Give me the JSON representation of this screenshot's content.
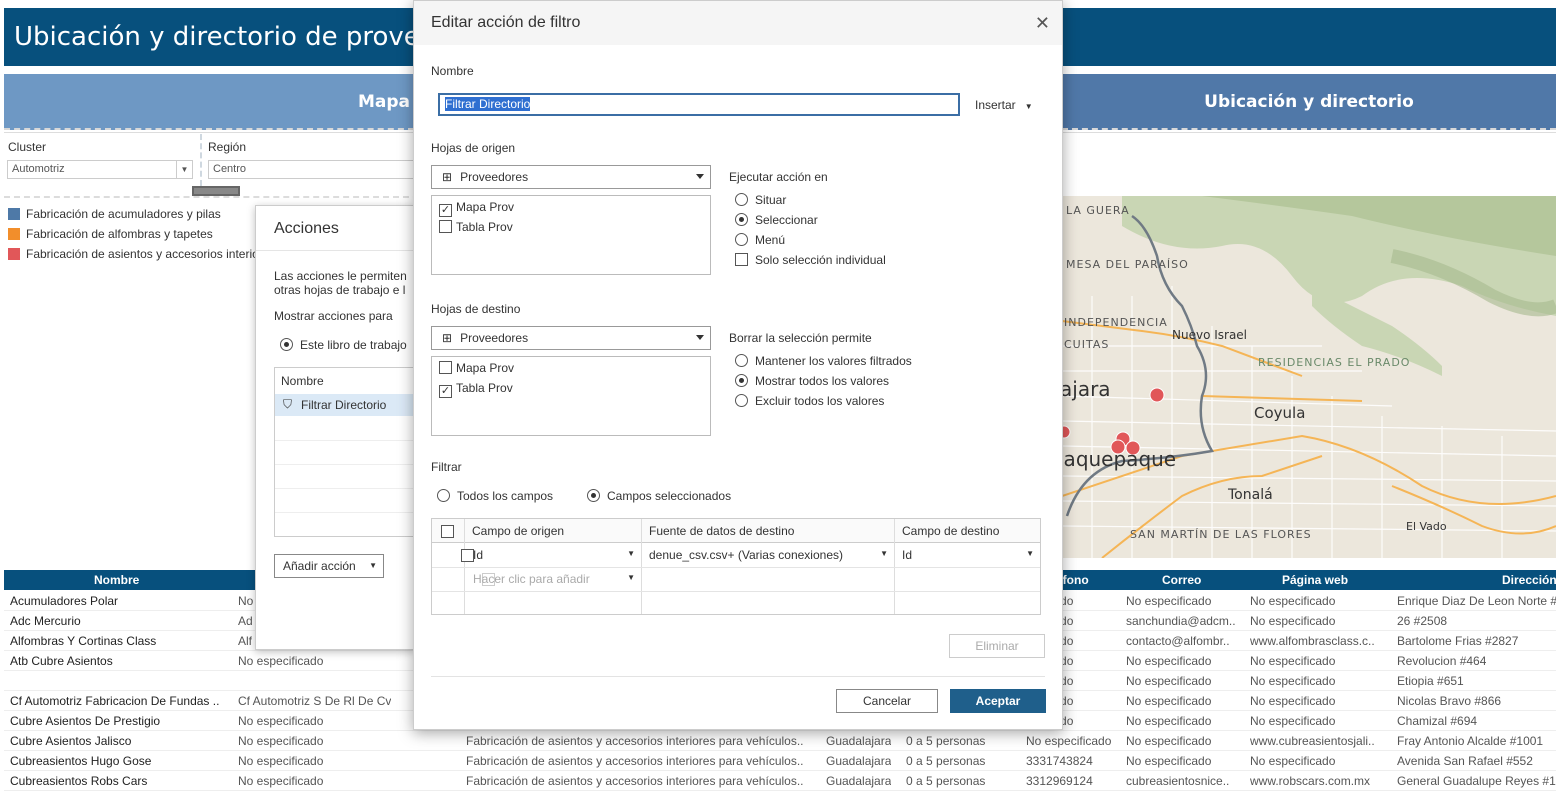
{
  "dashboard": {
    "title": "Ubicación y directorio de proveedores",
    "header_left": "Mapa",
    "header_right": "Ubicación y directorio",
    "filters": {
      "cluster_label": "Cluster",
      "cluster_value": "Automotriz",
      "region_label": "Región",
      "region_value": "Centro"
    },
    "legend": [
      {
        "label": "Fabricación de acumuladores y pilas",
        "color": "#4e79a7"
      },
      {
        "label": "Fabricación de alfombras y tapetes",
        "color": "#f28e2b"
      },
      {
        "label": "Fabricación de asientos y accesorios interiores para vehículos",
        "color": "#e15759"
      }
    ],
    "map_labels": [
      "LA GUERA",
      "MESA DEL PARAÍSO",
      "INDEPENDENCIA",
      "CUITAS",
      "Nuevo Israel",
      "RESIDENCIAS EL PRADO",
      "ajara",
      "Coyula",
      "laquepaque",
      "Tonalá",
      "SAN MARTÍN DE LAS FLORES",
      "El Vado"
    ],
    "table": {
      "headers": {
        "nombre": "Nombre",
        "telefono": "éfono",
        "correo": "Correo",
        "web": "Página web",
        "direccion": "Dirección"
      },
      "rows": [
        {
          "nombre": "Acumuladores Polar",
          "razon": "No",
          "actividad": "",
          "ciudad": "",
          "personal": "",
          "telefono": "ecificado",
          "correo": "No especificado",
          "web": "No especificado",
          "direccion": "Enrique Diaz De Leon Norte #"
        },
        {
          "nombre": "Adc Mercurio",
          "razon": "Ad",
          "actividad": "",
          "ciudad": "",
          "personal": "",
          "telefono": "ecificado",
          "correo": "sanchundia@adcm..",
          "web": "No especificado",
          "direccion": "26 #2508"
        },
        {
          "nombre": "Alfombras Y Cortinas Class",
          "razon": "Alf",
          "actividad": "",
          "ciudad": "",
          "personal": "",
          "telefono": "ecificado",
          "correo": "contacto@alfombr..",
          "web": "www.alfombrasclass.c..",
          "direccion": "Bartolome Frias #2827"
        },
        {
          "nombre": "Atb Cubre Asientos",
          "razon": "No especificado",
          "actividad": "",
          "ciudad": "",
          "personal": "",
          "telefono": "ecificado",
          "correo": "No especificado",
          "web": "No especificado",
          "direccion": "Revolucion #464"
        },
        {
          "nombre": "",
          "razon": "",
          "actividad": "",
          "ciudad": "",
          "personal": "",
          "telefono": "ecificado",
          "correo": "No especificado",
          "web": "No especificado",
          "direccion": "Etiopia #651"
        },
        {
          "nombre": "Cf Automotriz Fabricacion De Fundas ..",
          "razon": "Cf Automotriz S De Rl De Cv",
          "actividad": "",
          "ciudad": "",
          "personal": "",
          "telefono": "ecificado",
          "correo": "No especificado",
          "web": "No especificado",
          "direccion": "Nicolas Bravo #866"
        },
        {
          "nombre": "Cubre Asientos De Prestigio",
          "razon": "No especificado",
          "actividad": "",
          "ciudad": "",
          "personal": "",
          "telefono": "ecificado",
          "correo": "No especificado",
          "web": "No especificado",
          "direccion": "Chamizal #694"
        },
        {
          "nombre": "Cubre Asientos Jalisco",
          "razon": "No especificado",
          "actividad": "Fabricación de asientos y accesorios interiores para vehículos..",
          "ciudad": "Guadalajara",
          "personal": "0 a 5 personas",
          "telefono": "No especificado",
          "correo": "No especificado",
          "web": "www.cubreasientosjali..",
          "direccion": "Fray Antonio Alcalde #1001"
        },
        {
          "nombre": "Cubreasientos Hugo Gose",
          "razon": "No especificado",
          "actividad": "Fabricación de asientos y accesorios interiores para vehículos..",
          "ciudad": "Guadalajara",
          "personal": "0 a 5 personas",
          "telefono": "3331743824",
          "correo": "No especificado",
          "web": "No especificado",
          "direccion": "Avenida San Rafael #552"
        },
        {
          "nombre": "Cubreasientos Robs Cars",
          "razon": "No especificado",
          "actividad": "Fabricación de asientos y accesorios interiores para vehículos..",
          "ciudad": "Guadalajara",
          "personal": "0 a 5 personas",
          "telefono": "3312969124",
          "correo": "cubreasientosnice..",
          "web": "www.robscars.com.mx",
          "direccion": "General Guadalupe Reyes #1"
        }
      ]
    }
  },
  "acciones": {
    "title": "Acciones",
    "desc_line1": "Las acciones le permiten",
    "desc_line2": "otras hojas de trabajo e l",
    "show_for": "Mostrar acciones para",
    "scope": "Este libro de trabajo",
    "col_name": "Nombre",
    "item": "Filtrar Directorio",
    "add_button": "Añadir acción"
  },
  "dialog": {
    "title": "Editar acción de filtro",
    "name_label": "Nombre",
    "name_value": "Filtrar Directorio",
    "insert_label": "Insertar",
    "source_label": "Hojas de origen",
    "source_dropdown": "Proveedores",
    "source_sheets": [
      {
        "label": "Mapa Prov",
        "checked": true
      },
      {
        "label": "Tabla Prov",
        "checked": false
      }
    ],
    "run_on_label": "Ejecutar acción en",
    "run_on_options": [
      {
        "label": "Situar",
        "selected": false
      },
      {
        "label": "Seleccionar",
        "selected": true
      },
      {
        "label": "Menú",
        "selected": false
      }
    ],
    "single_select_label": "Solo selección individual",
    "target_label": "Hojas de destino",
    "target_dropdown": "Proveedores",
    "target_sheets": [
      {
        "label": "Mapa Prov",
        "checked": false
      },
      {
        "label": "Tabla Prov",
        "checked": true
      }
    ],
    "clear_label": "Borrar la selección permite",
    "clear_options": [
      {
        "label": "Mantener los valores filtrados",
        "selected": false
      },
      {
        "label": "Mostrar todos los valores",
        "selected": true
      },
      {
        "label": "Excluir todos los valores",
        "selected": false
      }
    ],
    "filter_label": "Filtrar",
    "filter_all": "Todos los campos",
    "filter_selected": "Campos seleccionados",
    "grid_headers": {
      "source_field": "Campo de origen",
      "target_ds": "Fuente de datos de destino",
      "target_field": "Campo de destino"
    },
    "grid_row": {
      "source_field": "Id",
      "target_ds": "denue_csv.csv+ (Varias conexiones)",
      "target_field": "Id"
    },
    "grid_add": "Hacer clic para añadir",
    "delete_button": "Eliminar",
    "cancel_button": "Cancelar",
    "accept_button": "Aceptar"
  }
}
